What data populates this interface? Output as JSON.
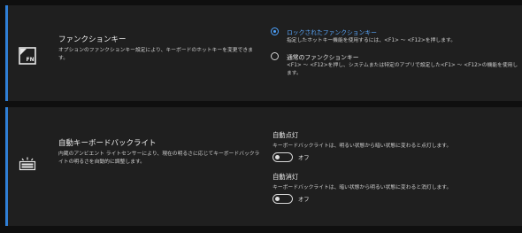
{
  "function_keys": {
    "title": "ファンクションキー",
    "description": "オプションのファンクションキー設定により、キーボードのホットキーを変更できます。",
    "icon": "fn-key-icon",
    "options": [
      {
        "label": "ロックされたファンクションキー",
        "description": "指定したホットキー機能を使用するには、<F1> ～ <F12>を押します。",
        "selected": true
      },
      {
        "label": "通常のファンクションキー",
        "description": "<F1> ～ <F12>を押し、システムまたは特定のアプリで設定した<F1> ～ <F12>の機能を使用します。",
        "selected": false
      }
    ]
  },
  "keyboard_backlight": {
    "title": "自動キーボードバックライト",
    "description": "内蔵のアンビエント ライトセンサーにより、現在の明るさに応じてキーボードバックライトの明るさを自動的に調整します。",
    "icon": "keyboard-backlight-icon",
    "auto_on": {
      "title": "自動点灯",
      "description": "キーボードバックライトは、明るい状態から暗い状態に変わると点灯します。",
      "state_label": "オフ",
      "enabled": false
    },
    "auto_off": {
      "title": "自動消灯",
      "description": "キーボードバックライトは、暗い状態から明るい状態に変わると消灯します。",
      "state_label": "オフ",
      "enabled": false
    }
  },
  "colors": {
    "accent": "#2f7fd6",
    "selected_radio": "#4da3ff",
    "panel_bg": "#1f1f1f",
    "page_bg": "#0f0f0f"
  }
}
